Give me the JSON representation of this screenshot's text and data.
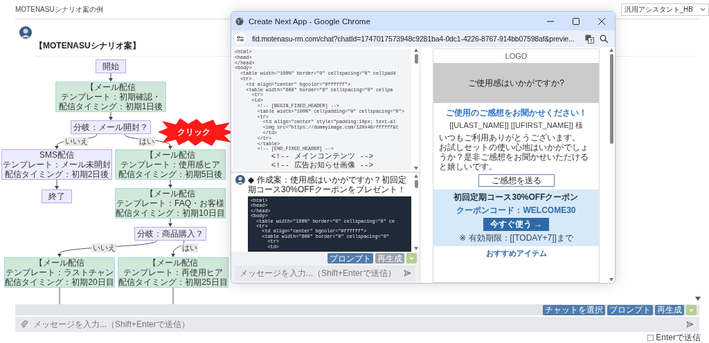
{
  "app": {
    "title": "MOTENASUシナリオ案の例",
    "assistant_select": "汎用アシスタント_HB"
  },
  "message": {
    "heading": "【MOTENASUシナリオ案】"
  },
  "flowchart": {
    "nodes": [
      {
        "kind": "terminal",
        "lines": [
          "開始"
        ]
      },
      {
        "kind": "mail",
        "lines": [
          "【メール配信",
          "テンプレート：初期確認・",
          "配信タイミング：初期1日後"
        ]
      },
      {
        "kind": "decision",
        "lines": [
          "分岐：メール開封？"
        ]
      },
      {
        "kind": "sms",
        "lines": [
          "SMS配信",
          "テンプレート：メール未開封",
          "配信タイミング：初期2日後"
        ]
      },
      {
        "kind": "mail",
        "lines": [
          "【メール配信",
          "テンプレート：使用感ヒア",
          "配信タイミング：初期5日後"
        ]
      },
      {
        "kind": "terminal",
        "lines": [
          "終了"
        ]
      },
      {
        "kind": "mail",
        "lines": [
          "【メール配信",
          "テンプレート：FAQ・お客様",
          "配信タイミング：初期10日目"
        ]
      },
      {
        "kind": "decision",
        "lines": [
          "分岐：商品購入？"
        ]
      },
      {
        "kind": "mail",
        "lines": [
          "【メール配信",
          "テンプレート：ラストチャン",
          "配信タイミング：初期20日目"
        ]
      },
      {
        "kind": "mail",
        "lines": [
          "【メール配信",
          "テンプレート：再使用ヒア",
          "配信タイミング：初期25日目"
        ]
      }
    ],
    "branch_labels": [
      "いいえ",
      "はい",
      "いいえ",
      "はい"
    ]
  },
  "click_callout": {
    "text": "クリック"
  },
  "browser": {
    "title": "Create Next App - Google Chrome",
    "url": "fid.motenasu-rm.com/chat?chatId=1747017573948c9281ba4-0dc1-4226-8767-914bb07598af&previe...",
    "code_lines": [
      "<html>",
      "<head>",
      "</head>",
      "<body>",
      "  <table width=\"100%\" border=\"0\" cellspacing=\"0\" cellpadd",
      "  <tr>",
      "    <td align=\"center\" bgcolor=\"#ffffff\">",
      "    <table width=\"600\" border=\"0\" cellspacing=\"0\" cellpa",
      "      <tr>",
      "      <td>",
      "        <!-- [BEGIN_FIXED_HEADER] -->",
      "        <table width=\"100%\" cellpadding=\"0\" cellspacing=\"0\">",
      "        <tr>",
      "          <td align=\"center\" style=\"padding:10px; text-al",
      "          <img src=\"https://dummyimage.com/120x40/ffffff&t",
      "          </td>",
      "        </tr>",
      "        </table>",
      "        <!-- [END_FIXED_HEADER] -->",
      "        <!-- メインコンテンツ -->",
      "        <!-- 広告お知らせ画像 -->"
    ],
    "chat": {
      "message": "◆ 作成案：使用感はいかがですか？初回定期コース30%OFFクーポンをプレゼント！",
      "code_lines": [
        "<html>",
        "<head>",
        "</head>",
        "<body>",
        "  <table width=\"100%\" border=\"0\" cellspacing=\"0\" ce",
        "  <tr>",
        "    <td align=\"center\" bgcolor=\"#ffffff\">",
        "    <table width=\"600\" border=\"0\" cellspacing=\"0\"",
        "      <tr>",
        "      <td>"
      ],
      "buttons": [
        {
          "label": "プロンプト",
          "kind": "primary"
        },
        {
          "label": "再生成",
          "kind": "secondary"
        },
        {
          "kind": "confirm"
        }
      ],
      "placeholder": "メッセージを入力...（Shift+Enterで送信）"
    },
    "email": {
      "logo": "LOGO",
      "image_caption": "ご使用感はいかがですか?",
      "heading": "ご使用のご感想をお聞かせください！",
      "recipient": "[[ULAST_NAME]] [[UFIRST_NAME]] 様",
      "body": [
        "いつもご利用ありがとうございます。",
        "お試しセットの使い心地はいかがでしょうか？是非ご感想をお聞かせいただけると嬉しいです。"
      ],
      "button": "ご感想を送る",
      "coupon": {
        "title": "初回定期コース30%OFFクーポン",
        "code": "クーポンコード：WELCOME30",
        "button": "今すぐ使う →",
        "note": "※ 有効期限：[[TODAY+7]]まで"
      },
      "section_title": "おすすめアイテム"
    }
  },
  "composer": {
    "buttons": [
      {
        "label": "チャットを選択",
        "kind": "primary"
      },
      {
        "label": "プロンプト",
        "kind": "primary"
      },
      {
        "label": "再生成",
        "kind": "primary"
      },
      {
        "kind": "confirm"
      }
    ],
    "placeholder": "メッセージを入力...（Shift+Enterで送信）",
    "enter_to_send": {
      "label": "Enterで送信",
      "checked": false
    }
  }
}
